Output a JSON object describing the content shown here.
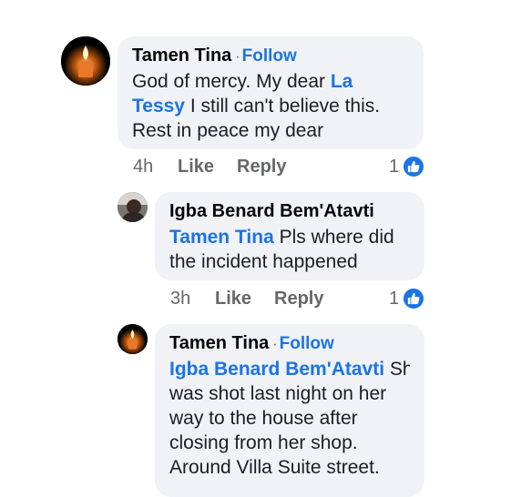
{
  "comments": [
    {
      "author": "Tamen Tina",
      "separator": "·",
      "follow_label": "Follow",
      "mention": "La Tessy",
      "text_before": "God of mercy. My dear ",
      "mention_part1": "La",
      "mention_part2": "Tessy",
      "text_after": " I still can't believe this. Rest in peace my dear",
      "line1_text": "God of mercy. My dear ",
      "line2_text": " I still can't believe this.",
      "line3_text": "Rest in peace my dear",
      "time": "4h",
      "like_label": "Like",
      "reply_label": "Reply",
      "like_count": "1",
      "avatar_icon": "candle-icon"
    },
    {
      "author": "Igba Benard Bem'Atavti",
      "mention": "Tamen Tina",
      "line1_text": " Pls where did",
      "line2_text": "the incident happened",
      "time": "3h",
      "like_label": "Like",
      "reply_label": "Reply",
      "like_count": "1",
      "avatar_icon": "profile-photo"
    },
    {
      "author": "Tamen Tina",
      "separator": "·",
      "follow_label": "Follow",
      "mention": "Igba Benard Bem'Atavti",
      "line1_text": " She",
      "line2_text": "was shot last night on her",
      "line3_text": "way to the house after",
      "line4_text": "closing from her shop.",
      "line5_text": "Around Villa Suite street.",
      "avatar_icon": "candle-icon"
    }
  ],
  "colors": {
    "accent": "#1b74e4",
    "bubble": "#f0f2f5",
    "meta": "#65676b"
  }
}
